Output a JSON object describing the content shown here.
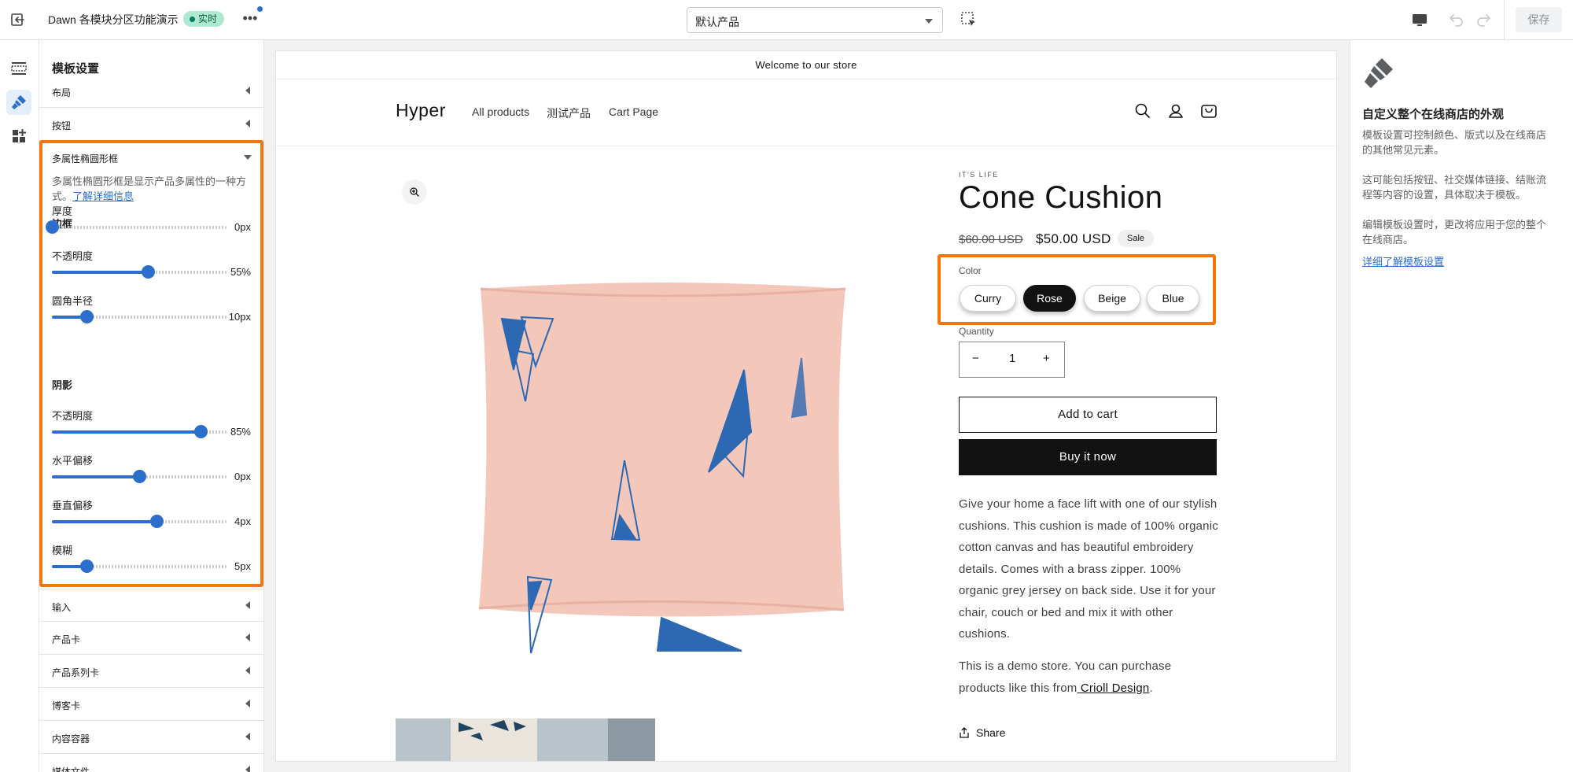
{
  "topbar": {
    "title": "Dawn 各模块分区功能演示",
    "status_badge": "实时",
    "template_select": "默认产品",
    "save_label": "保存"
  },
  "settings": {
    "heading": "模板设置",
    "sections_top": [
      {
        "label": "布局"
      },
      {
        "label": "按钮"
      }
    ],
    "open_section": {
      "label": "多属性椭圆形框",
      "description": "多属性椭圆形框是显示产品多属性的一种方式。",
      "learn_more": "了解详细信息",
      "border_group": "边框",
      "shadow_group": "阴影",
      "sliders": [
        {
          "label": "厚度",
          "value": "0px",
          "fraction": 0.0
        },
        {
          "label": "不透明度",
          "value": "55%",
          "fraction": 0.55
        },
        {
          "label": "圆角半径",
          "value": "10px",
          "fraction": 0.2
        },
        {
          "label": "不透明度",
          "value": "85%",
          "fraction": 0.85
        },
        {
          "label": "水平偏移",
          "value": "0px",
          "fraction": 0.5
        },
        {
          "label": "垂直偏移",
          "value": "4px",
          "fraction": 0.6
        },
        {
          "label": "模糊",
          "value": "5px",
          "fraction": 0.2
        }
      ]
    },
    "sections_bottom": [
      {
        "label": "输入"
      },
      {
        "label": "产品卡"
      },
      {
        "label": "产品系列卡"
      },
      {
        "label": "博客卡"
      },
      {
        "label": "内容容器"
      },
      {
        "label": "媒体文件"
      }
    ]
  },
  "preview": {
    "announcement": "Welcome to our store",
    "logo": "Hyper",
    "nav": [
      "All products",
      "测试产品",
      "Cart Page"
    ],
    "vendor": "IT'S LIFE",
    "product_title": "Cone Cushion",
    "price_old": "$60.00 USD",
    "price_new": "$50.00 USD",
    "sale_badge": "Sale",
    "color_label": "Color",
    "colors": [
      "Curry",
      "Rose",
      "Beige",
      "Blue"
    ],
    "selected_color": "Rose",
    "quantity_label": "Quantity",
    "quantity": "1",
    "minus": "−",
    "plus": "+",
    "add_to_cart": "Add to cart",
    "buy_now": "Buy it now",
    "description": "Give your home a face lift with one of our stylish cushions. This cushion is made of 100% organic cotton canvas and has beautiful embroidery details. Comes with a brass zipper. 100% organic grey jersey on back side. Use it for your chair, couch or bed and mix it with other cushions.",
    "demo_text": "This is a demo store. You can purchase products like this from",
    "demo_link": " Crioll Design",
    "demo_end": ".",
    "share": "Share"
  },
  "info": {
    "title": "自定义整个在线商店的外观",
    "p1": "模板设置可控制颜色、版式以及在线商店的其他常见元素。",
    "p2": "这可能包括按钮、社交媒体链接、结账流程等内容的设置，具体取决于模板。",
    "p3": "编辑模板设置时，更改将应用于您的整个在线商店。",
    "link": "详细了解模板设置"
  },
  "colors": {
    "accent": "#2c6ecb",
    "highlight": "#f2760c",
    "live_badge": "#aee9d1",
    "cushion": "#f4c9bd",
    "embroidery": "#2d68b3"
  }
}
